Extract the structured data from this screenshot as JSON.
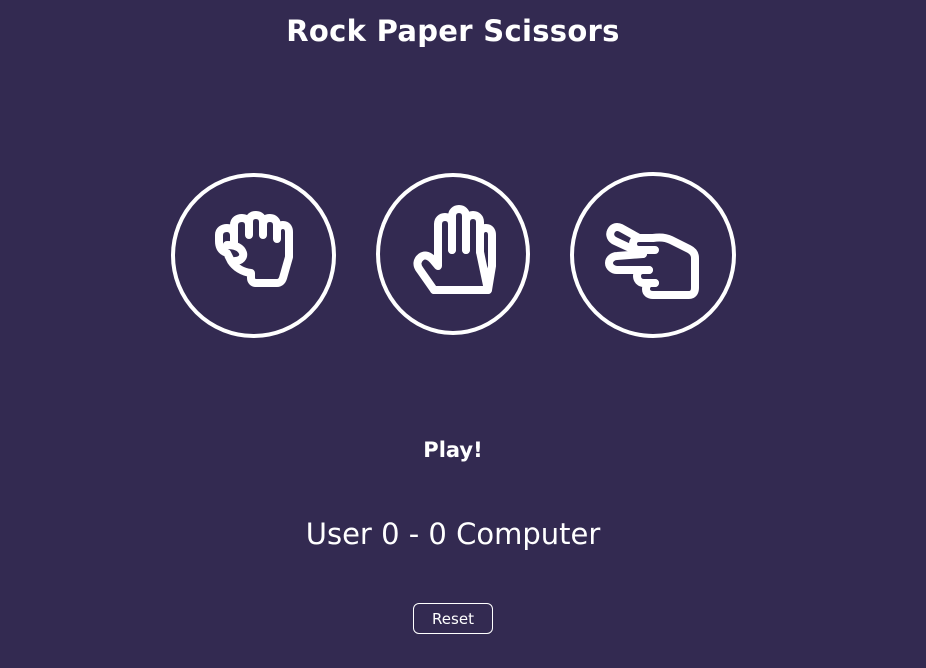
{
  "game": {
    "title": "Rock Paper Scissors",
    "choices": [
      {
        "id": "rock",
        "icon": "rock-hand-icon"
      },
      {
        "id": "paper",
        "icon": "paper-hand-icon"
      },
      {
        "id": "scissors",
        "icon": "scissors-hand-icon"
      }
    ],
    "status": "Play!",
    "score": {
      "user_label": "User",
      "user_score": 0,
      "separator": "-",
      "computer_score": 0,
      "computer_label": "Computer"
    },
    "reset_label": "Reset"
  },
  "colors": {
    "background": "#332a51",
    "foreground": "#ffffff"
  }
}
